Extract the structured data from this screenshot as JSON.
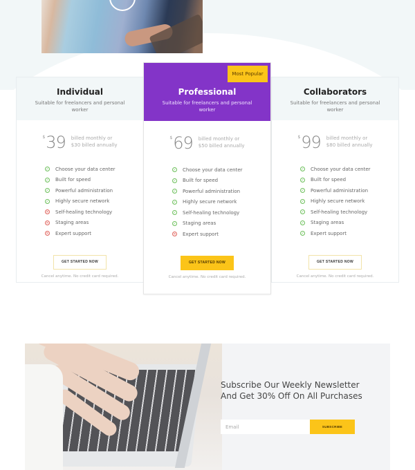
{
  "hero": {
    "image_alt": "team-working-with-tablet-video-thumbnail"
  },
  "plans": [
    {
      "name": "Individual",
      "subtitle": "Suitable for freelancers and personal worker",
      "currency": "$",
      "price": "39",
      "billing_line1": "billed monthly or",
      "billing_line2": "$30 billed annually",
      "featured": false,
      "features": [
        {
          "label": "Choose your data center",
          "included": true
        },
        {
          "label": "Built for speed",
          "included": true
        },
        {
          "label": "Powerful administration",
          "included": true
        },
        {
          "label": "Highly secure network",
          "included": true
        },
        {
          "label": "Self-healing technology",
          "included": false
        },
        {
          "label": "Staging areas",
          "included": false
        },
        {
          "label": "Expert support",
          "included": false
        }
      ],
      "cta": "GET STARTED NOW",
      "note": "Cancel anytime. No credit card required."
    },
    {
      "name": "Professional",
      "subtitle": "Suitable for freelancers and personal worker",
      "badge": "Most Popular",
      "currency": "$",
      "price": "69",
      "billing_line1": "billed monthly or",
      "billing_line2": "$50 billed annually",
      "featured": true,
      "features": [
        {
          "label": "Choose your data center",
          "included": true
        },
        {
          "label": "Built for speed",
          "included": true
        },
        {
          "label": "Powerful administration",
          "included": true
        },
        {
          "label": "Highly secure network",
          "included": true
        },
        {
          "label": "Self-healing technology",
          "included": true
        },
        {
          "label": "Staging areas",
          "included": true
        },
        {
          "label": "Expert support",
          "included": false
        }
      ],
      "cta": "GET STARTED NOW",
      "note": "Cancel anytime. No credit card required."
    },
    {
      "name": "Collaborators",
      "subtitle": "Suitable for freelancers and personal worker",
      "currency": "$",
      "price": "99",
      "billing_line1": "billed monthly or",
      "billing_line2": "$80 billed annually",
      "featured": false,
      "features": [
        {
          "label": "Choose your data center",
          "included": true
        },
        {
          "label": "Built for speed",
          "included": true
        },
        {
          "label": "Powerful administration",
          "included": true
        },
        {
          "label": "Highly secure network",
          "included": true
        },
        {
          "label": "Self-healing technology",
          "included": true
        },
        {
          "label": "Staging areas",
          "included": true
        },
        {
          "label": "Expert support",
          "included": true
        }
      ],
      "cta": "GET STARTED NOW",
      "note": "Cancel anytime. No credit card required."
    }
  ],
  "icons": {
    "included": "✓",
    "excluded": "✕"
  },
  "newsletter": {
    "title": "Subscribe Our Weekly Newsletter And Get 30% Off On All Purchases",
    "email_placeholder": "Email",
    "email_value": "",
    "subscribe_label": "SUBSCRIBE"
  },
  "colors": {
    "accent_purple": "#8334c8",
    "accent_yellow": "#fbc419",
    "check_green": "#6cbf5a",
    "cross_red": "#e0625b"
  }
}
